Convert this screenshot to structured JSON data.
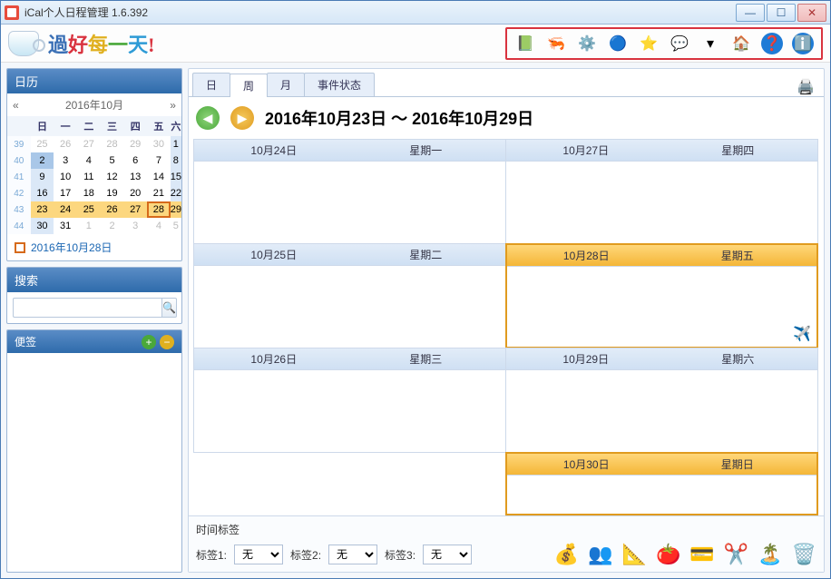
{
  "window": {
    "title": "iCal个人日程管理    1.6.392"
  },
  "slogan": [
    {
      "t": "過",
      "c": "#3a6fb5"
    },
    {
      "t": "好",
      "c": "#d9333f"
    },
    {
      "t": "每",
      "c": "#e0b020"
    },
    {
      "t": "一",
      "c": "#4aa83a"
    },
    {
      "t": "天",
      "c": "#2e9bd6"
    },
    {
      "t": "!",
      "c": "#d9333f"
    }
  ],
  "top_tools": [
    {
      "name": "notebook-icon",
      "glyph": "📗",
      "bg": ""
    },
    {
      "name": "share-icon",
      "glyph": "🦐",
      "bg": ""
    },
    {
      "name": "settings-icon",
      "glyph": "⚙️",
      "bg": ""
    },
    {
      "name": "globe-icon",
      "glyph": "🔵",
      "bg": ""
    },
    {
      "name": "favorite-icon",
      "glyph": "⭐",
      "bg": ""
    },
    {
      "name": "chat-icon",
      "glyph": "💬",
      "bg": ""
    },
    {
      "name": "dropdown-icon",
      "glyph": "▾",
      "bg": ""
    },
    {
      "name": "home-icon",
      "glyph": "🏠",
      "bg": ""
    },
    {
      "name": "help-icon",
      "glyph": "❓",
      "bg": "#1e7bd6"
    },
    {
      "name": "info-icon",
      "glyph": "ℹ️",
      "bg": "#1e7bd6"
    }
  ],
  "sidebar": {
    "calendar_title": "日历",
    "month_label": "2016年10月",
    "prev": "«",
    "next": "»",
    "dow": [
      "日",
      "一",
      "二",
      "三",
      "四",
      "五",
      "六"
    ],
    "weeks": [
      {
        "wk": "39",
        "days": [
          {
            "n": "25",
            "o": 1
          },
          {
            "n": "26",
            "o": 1
          },
          {
            "n": "27",
            "o": 1
          },
          {
            "n": "28",
            "o": 1
          },
          {
            "n": "29",
            "o": 1
          },
          {
            "n": "30",
            "o": 1
          },
          {
            "n": "1",
            "sat": 1
          }
        ]
      },
      {
        "wk": "40",
        "days": [
          {
            "n": "2",
            "sel": 1
          },
          {
            "n": "3"
          },
          {
            "n": "4"
          },
          {
            "n": "5"
          },
          {
            "n": "6"
          },
          {
            "n": "7"
          },
          {
            "n": "8",
            "sat": 1
          }
        ]
      },
      {
        "wk": "41",
        "days": [
          {
            "n": "9",
            "sun": 1
          },
          {
            "n": "10"
          },
          {
            "n": "11"
          },
          {
            "n": "12"
          },
          {
            "n": "13"
          },
          {
            "n": "14"
          },
          {
            "n": "15",
            "sat": 1
          }
        ]
      },
      {
        "wk": "42",
        "days": [
          {
            "n": "16",
            "sun": 1
          },
          {
            "n": "17"
          },
          {
            "n": "18"
          },
          {
            "n": "19"
          },
          {
            "n": "20"
          },
          {
            "n": "21"
          },
          {
            "n": "22",
            "sat": 1
          }
        ]
      },
      {
        "wk": "43",
        "days": [
          {
            "n": "23",
            "hl": 1
          },
          {
            "n": "24",
            "hl": 1
          },
          {
            "n": "25",
            "hl": 1
          },
          {
            "n": "26",
            "hl": 1
          },
          {
            "n": "27",
            "hl": 1
          },
          {
            "n": "28",
            "today": 1
          },
          {
            "n": "29",
            "hl": 1
          }
        ]
      },
      {
        "wk": "44",
        "days": [
          {
            "n": "30",
            "sun": 1
          },
          {
            "n": "31"
          },
          {
            "n": "1",
            "o": 1
          },
          {
            "n": "2",
            "o": 1
          },
          {
            "n": "3",
            "o": 1
          },
          {
            "n": "4",
            "o": 1
          },
          {
            "n": "5",
            "o": 1
          }
        ]
      }
    ],
    "today_link": "2016年10月28日",
    "search_title": "搜索",
    "search_placeholder": "",
    "notes_title": "便签"
  },
  "tabs": [
    {
      "label": "日",
      "active": false
    },
    {
      "label": "周",
      "active": true
    },
    {
      "label": "月",
      "active": false
    },
    {
      "label": "事件状态",
      "active": false
    }
  ],
  "range": "2016年10月23日 ～ 2016年10月29日",
  "days": [
    {
      "date": "10月24日",
      "dow": "星期一",
      "hl": false
    },
    {
      "date": "10月27日",
      "dow": "星期四",
      "hl": false
    },
    {
      "date": "10月25日",
      "dow": "星期二",
      "hl": false
    },
    {
      "date": "10月28日",
      "dow": "星期五",
      "hl": true,
      "plane": true
    },
    {
      "date": "10月26日",
      "dow": "星期三",
      "hl": false
    },
    {
      "date": "10月29日",
      "dow": "星期六",
      "hl": false
    },
    {
      "date": "10月30日",
      "dow": "星期日",
      "hl": true,
      "half": true
    }
  ],
  "bottom": {
    "title": "时间标签",
    "labels": [
      "标签1:",
      "标签2:",
      "标签3:"
    ],
    "option": "无",
    "tools": [
      {
        "name": "money-icon",
        "glyph": "💰"
      },
      {
        "name": "contacts-icon",
        "glyph": "👥"
      },
      {
        "name": "plan-icon",
        "glyph": "📐"
      },
      {
        "name": "food-icon",
        "glyph": "🍅"
      },
      {
        "name": "card-icon",
        "glyph": "💳"
      },
      {
        "name": "cut-icon",
        "glyph": "✂️"
      },
      {
        "name": "travel-icon",
        "glyph": "🏝️"
      },
      {
        "name": "trash-icon",
        "glyph": "🗑️"
      }
    ]
  }
}
